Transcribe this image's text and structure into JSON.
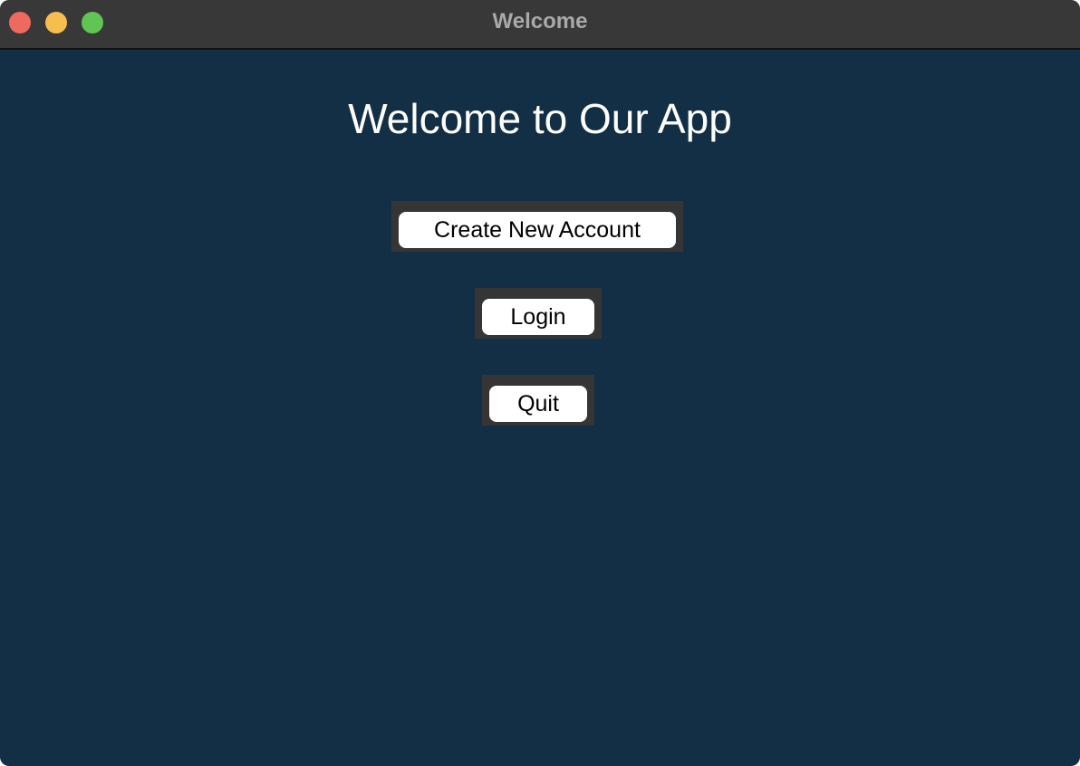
{
  "window": {
    "title": "Welcome",
    "traffic_lights": {
      "close": "#ee6a5f",
      "minimize": "#f5be4f",
      "zoom": "#61c554"
    }
  },
  "main": {
    "heading": "Welcome to Our App",
    "buttons": [
      {
        "label": "Create New Account"
      },
      {
        "label": "Login"
      },
      {
        "label": "Quit"
      }
    ]
  }
}
